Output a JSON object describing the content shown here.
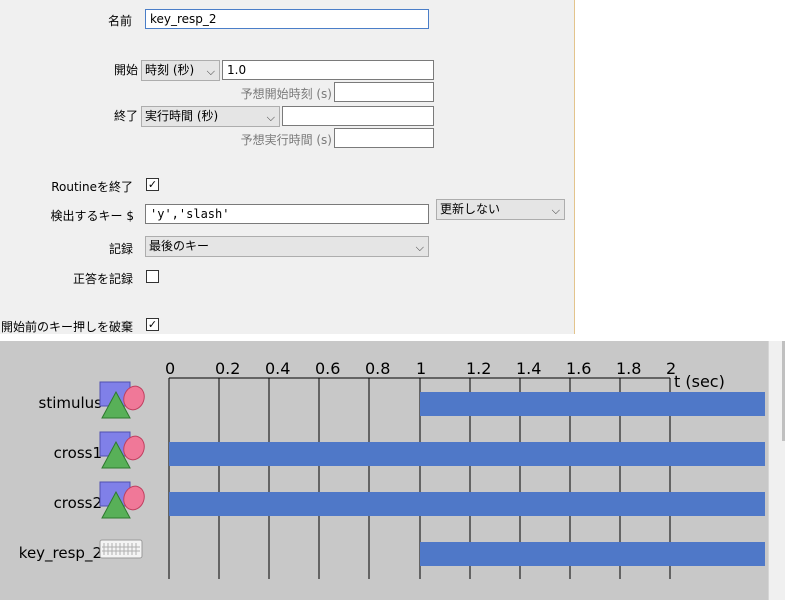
{
  "dialog": {
    "name_label": "名前",
    "name_value": "key_resp_2",
    "start_label": "開始",
    "start_type": "時刻 (秒)",
    "start_value": "1.0",
    "expected_start_label": "予想開始時刻 (s)",
    "expected_start_value": "",
    "stop_label": "終了",
    "stop_type": "実行時間 (秒)",
    "stop_value": "",
    "expected_duration_label": "予想実行時間 (s)",
    "expected_duration_value": "",
    "force_end_label": "Routineを終了",
    "force_end_checked": true,
    "allowed_keys_label": "検出するキー $",
    "allowed_keys_value": "'y','slash'",
    "allowed_keys_update": "更新しない",
    "store_label": "記録",
    "store_value": "最後のキー",
    "store_correct_label": "正答を記録",
    "store_correct_checked": false,
    "discard_prev_label": "開始前のキー押しを破棄",
    "discard_prev_checked": true
  },
  "timeline": {
    "axis_label": "t (sec)",
    "ticks": [
      "0",
      "0.2",
      "0.4",
      "0.6",
      "0.8",
      "1",
      "1.2",
      "1.4",
      "1.6",
      "1.8",
      "2"
    ],
    "components": [
      {
        "name": "stimulus",
        "icon": "shapes-icon",
        "start": 1.0,
        "end": null
      },
      {
        "name": "cross1",
        "icon": "shapes-icon",
        "start": 0.0,
        "end": null
      },
      {
        "name": "cross2",
        "icon": "shapes-icon",
        "start": 0.0,
        "end": null
      },
      {
        "name": "key_resp_2",
        "icon": "keyboard-icon",
        "start": 1.0,
        "end": null
      }
    ],
    "bar_color": "#4f78c8"
  }
}
